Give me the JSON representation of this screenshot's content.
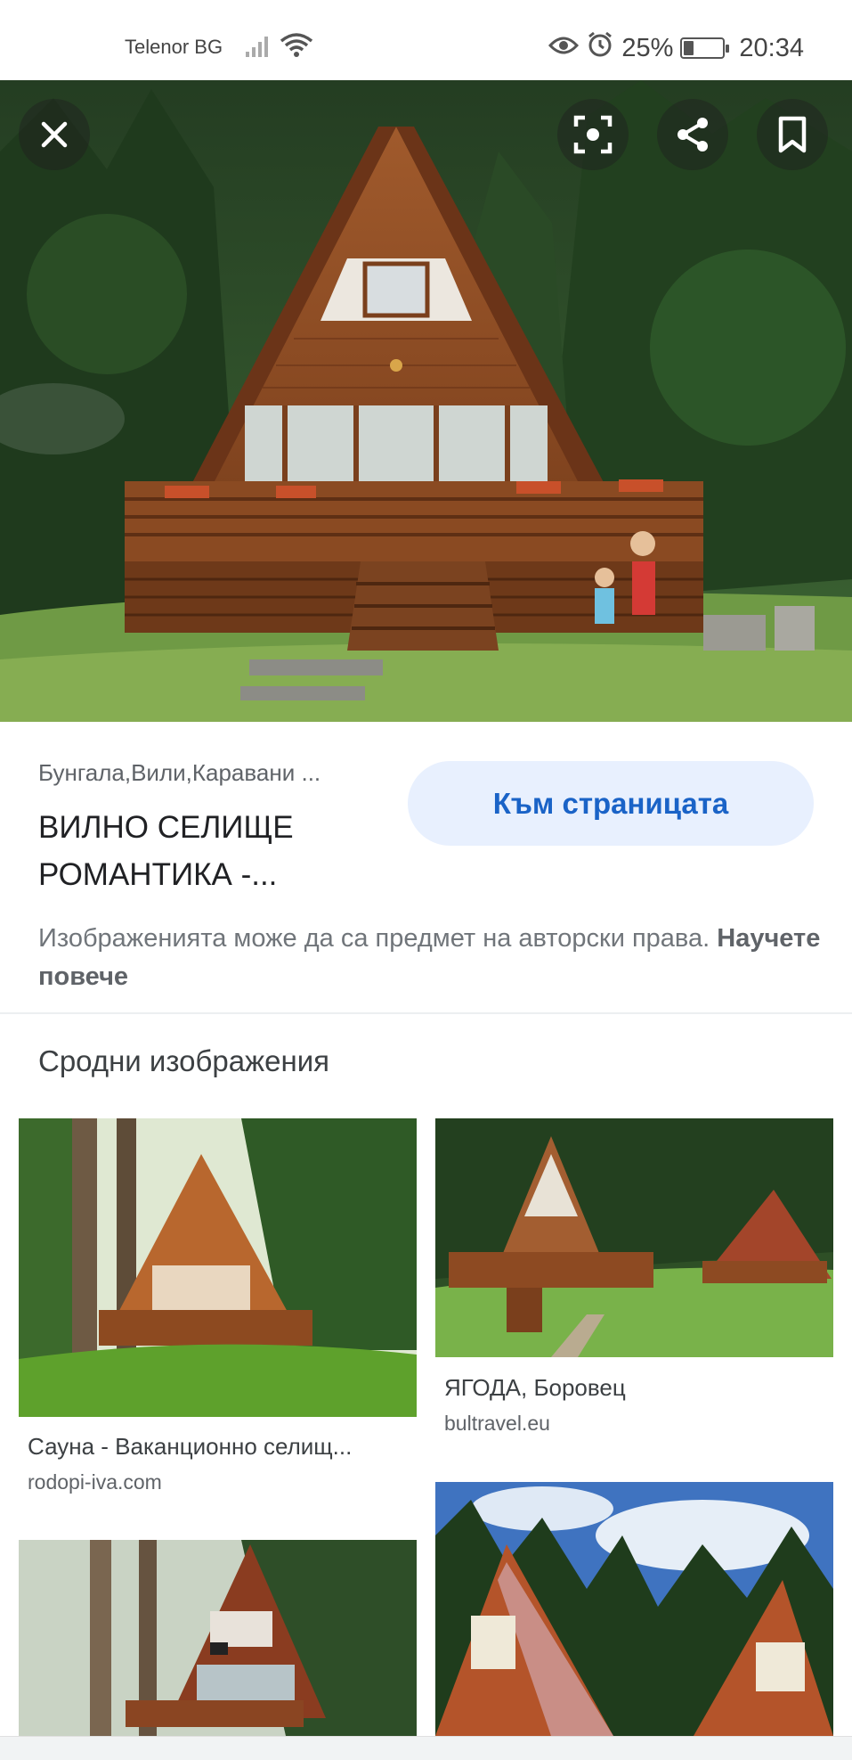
{
  "status_bar": {
    "carrier": "Telenor BG",
    "battery_percent": "25%",
    "battery_level": 0.25,
    "time": "20:34",
    "icons": [
      "signal-icon",
      "wifi-icon",
      "eye-icon",
      "alarm-icon",
      "battery-icon"
    ]
  },
  "viewer": {
    "buttons": [
      "close-icon",
      "lens-icon",
      "share-icon",
      "bookmark-icon"
    ]
  },
  "result": {
    "site_name": "Бунгала,Вили,Каравани ...",
    "title": "ВИЛНО СЕЛИЩЕ РОМАНТИКА -...",
    "visit_button": "Към страницата",
    "copyright_text": "Изображенията може да са предмет на авторски права.",
    "learn_more": "Научете повече"
  },
  "related": {
    "heading": "Сродни изображения",
    "items": [
      {
        "caption": "Сауна - Ваканционно селищ...",
        "source": "rodopi-iva.com"
      },
      {
        "caption": "ЯГОДА, Боровец",
        "source": "bultravel.eu"
      },
      {
        "caption": "",
        "source": ""
      },
      {
        "caption": "",
        "source": ""
      }
    ]
  },
  "colors": {
    "accent": "#1a63c7",
    "button_bg": "#e8f0fe",
    "text_primary": "#202124",
    "text_secondary": "#70757a"
  }
}
